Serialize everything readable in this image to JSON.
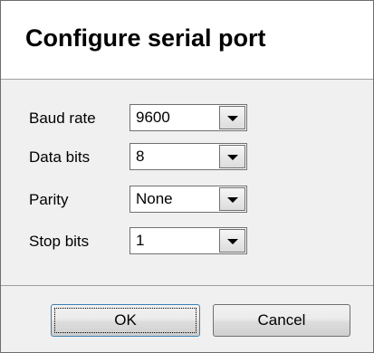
{
  "dialog": {
    "title": "Configure serial port"
  },
  "fields": [
    {
      "label": "Baud rate",
      "value": "9600"
    },
    {
      "label": "Data bits",
      "value": "8"
    },
    {
      "label": "Parity",
      "value": "None"
    },
    {
      "label": "Stop bits",
      "value": "1"
    }
  ],
  "buttons": {
    "ok_label": "OK",
    "cancel_label": "Cancel"
  },
  "icons": {
    "dropdown": "chevron-down-icon"
  }
}
